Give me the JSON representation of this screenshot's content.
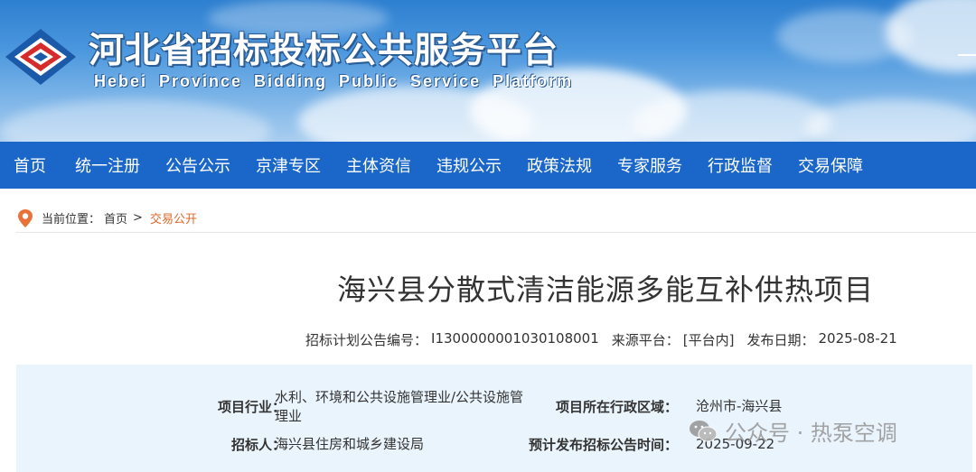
{
  "header": {
    "title": "河北省招标投标公共服务平台",
    "subtitle": "Hebei  Province  Bidding  Public  Service  Platform",
    "logo_icon": "hebei-logo-icon"
  },
  "nav": {
    "items": [
      "首页",
      "统一注册",
      "公告公示",
      "京津专区",
      "主体资信",
      "违规公示",
      "政策法规",
      "专家服务",
      "行政监督",
      "交易保障"
    ]
  },
  "breadcrumb": {
    "prefix": "当前位置：",
    "home": "首页",
    "separator": ">",
    "current": "交易公开"
  },
  "article": {
    "title": "海兴县分散式清洁能源多能互补供热项目",
    "meta": {
      "plan_no_label": "招标计划公告编号：",
      "plan_no": "I1300000001030108001",
      "source_label": "来源平台：",
      "source": "[平台内]",
      "date_label": "发布日期：",
      "date": "2025-08-21"
    }
  },
  "info": {
    "industry_label": "项目行业：",
    "industry": "水利、环境和公共设施管理业/公共设施管理业",
    "region_label": "项目所在行政区域：",
    "region": "沧州市-海兴县",
    "tenderer_label": "招标人：",
    "tenderer": "海兴县住房和城乡建设局",
    "expected_label": "预计发布招标公告时间：",
    "expected": "2025-09-22"
  },
  "watermark": {
    "text": "公众号 · 热泵空调",
    "icon": "wechat-icon"
  },
  "colors": {
    "nav_bg": "#1b67c9",
    "accent_orange": "#e0662a",
    "info_bg": "#eaf4fc"
  }
}
